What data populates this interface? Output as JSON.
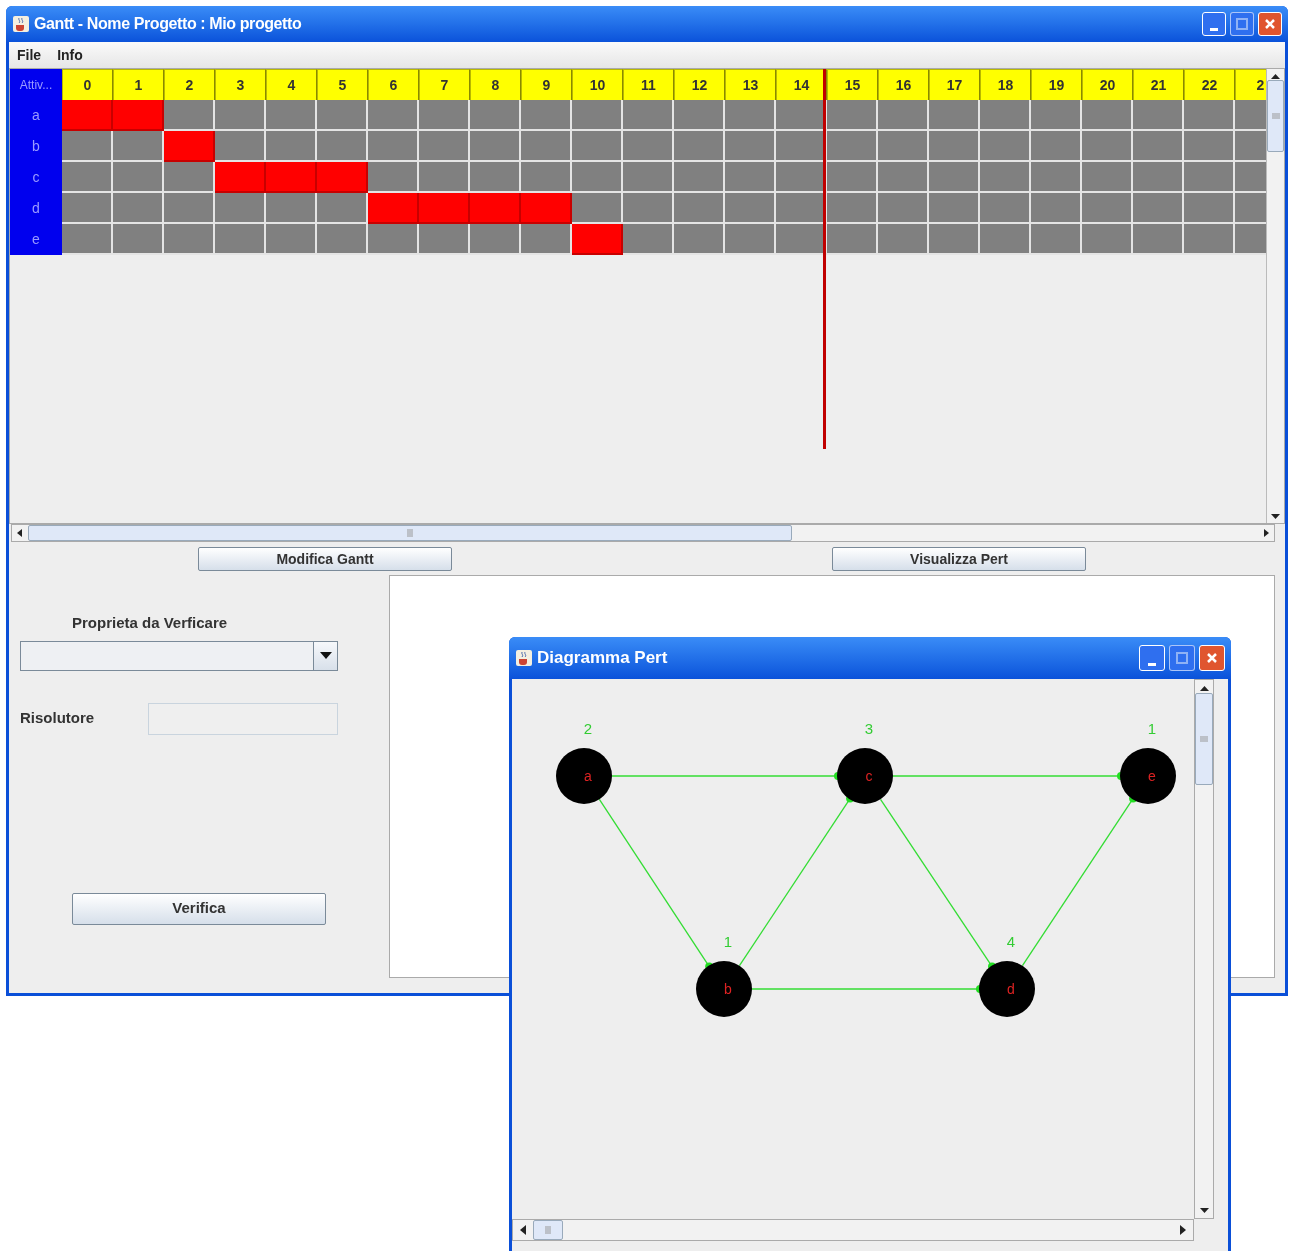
{
  "window": {
    "title": "Gantt - Nome Progetto : Mio progetto"
  },
  "menu": [
    "File",
    "Info"
  ],
  "gantt": {
    "corner_header": "Attiv...",
    "columns": [
      "0",
      "1",
      "2",
      "3",
      "4",
      "5",
      "6",
      "7",
      "8",
      "9",
      "10",
      "11",
      "12",
      "13",
      "14",
      "15",
      "16",
      "17",
      "18",
      "19",
      "20",
      "21",
      "22",
      "2"
    ],
    "rows": [
      {
        "label": "a",
        "cells": [
          true,
          true,
          false,
          false,
          false,
          false,
          false,
          false,
          false,
          false,
          false,
          false,
          false,
          false,
          false,
          false,
          false,
          false,
          false,
          false,
          false,
          false,
          false,
          false
        ]
      },
      {
        "label": "b",
        "cells": [
          false,
          false,
          true,
          false,
          false,
          false,
          false,
          false,
          false,
          false,
          false,
          false,
          false,
          false,
          false,
          false,
          false,
          false,
          false,
          false,
          false,
          false,
          false,
          false
        ]
      },
      {
        "label": "c",
        "cells": [
          false,
          false,
          false,
          true,
          true,
          true,
          false,
          false,
          false,
          false,
          false,
          false,
          false,
          false,
          false,
          false,
          false,
          false,
          false,
          false,
          false,
          false,
          false,
          false
        ]
      },
      {
        "label": "d",
        "cells": [
          false,
          false,
          false,
          false,
          false,
          false,
          true,
          true,
          true,
          true,
          false,
          false,
          false,
          false,
          false,
          false,
          false,
          false,
          false,
          false,
          false,
          false,
          false,
          false
        ]
      },
      {
        "label": "e",
        "cells": [
          false,
          false,
          false,
          false,
          false,
          false,
          false,
          false,
          false,
          false,
          true,
          false,
          false,
          false,
          false,
          false,
          false,
          false,
          false,
          false,
          false,
          false,
          false,
          false
        ]
      }
    ]
  },
  "buttons": [
    "Modifica Gantt",
    "Visualizza Pert"
  ],
  "verify_panel": {
    "property_label": "Proprieta da Verficare",
    "solver_label": "Risolutore",
    "verify_button": "Verifica"
  },
  "pert_window": {
    "title": "Diagramma Pert",
    "nodes": [
      {
        "label": "a",
        "duration": "2"
      },
      {
        "label": "c",
        "duration": "3"
      },
      {
        "label": "e",
        "duration": "1"
      },
      {
        "label": "b",
        "duration": "1"
      },
      {
        "label": "d",
        "duration": "4"
      }
    ]
  }
}
